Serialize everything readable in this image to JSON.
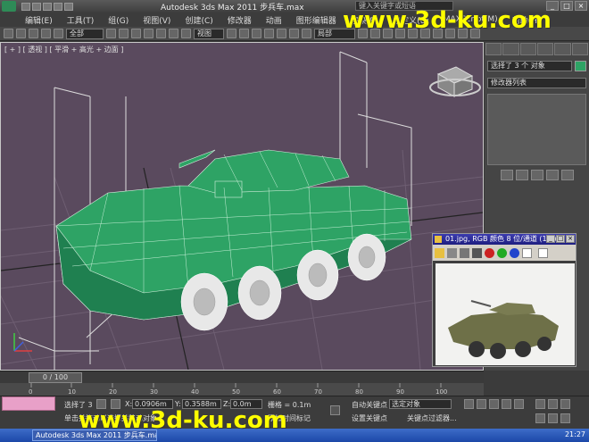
{
  "window": {
    "title": "Autodesk 3ds Max  2011     步兵车.max",
    "search_placeholder": "键入关键字或短语",
    "buttons": [
      "_",
      "□",
      "×"
    ]
  },
  "menubar": {
    "items": [
      "编辑(E)",
      "工具(T)",
      "组(G)",
      "视图(V)",
      "创建(C)",
      "修改器",
      "动画",
      "图形编辑器",
      "渲染(R)",
      "自定义(U)",
      "MAXScript(M)",
      "帮助(H)"
    ]
  },
  "toolbar": {
    "filter": "全部",
    "coord": "视图",
    "set": "局部"
  },
  "viewport": {
    "label": "[ + ] [ 透视 ] [ 平滑 + 高光 + 边面 ]",
    "bg": "#5a4a5e",
    "wire_color": "#2ea365"
  },
  "right_panel": {
    "selection": "选择了 3 个 对象",
    "modifier_list": "修改器列表",
    "color": "#2ea365"
  },
  "image_window": {
    "title": "01.jpg, RGB 颜色 8 位/通道 (1:1)",
    "channels": [
      "#cc2222",
      "#22aa22",
      "#2244cc"
    ]
  },
  "timeline": {
    "frame": "0 / 100",
    "ticks": [
      "0",
      "10",
      "20",
      "30",
      "40",
      "50",
      "60",
      "70",
      "80",
      "90",
      "100"
    ]
  },
  "status": {
    "selected": "选择了 3",
    "x": "0.0906m",
    "y": "0.3588m",
    "z": "0.0m",
    "grid": "栅格 = 0.1m",
    "auto_key": "自动关键点",
    "selected_obj": "选定对象",
    "set_key": "设置关键点",
    "key_filter": "关键点过滤器...",
    "add_time_tag": "添加时间标记",
    "prompt": "单击并拖动以选择并移动对象",
    "clock": "21:27"
  },
  "watermark": {
    "top": "www.3d-ku.com",
    "bottom": "www.3d-ku.com"
  }
}
